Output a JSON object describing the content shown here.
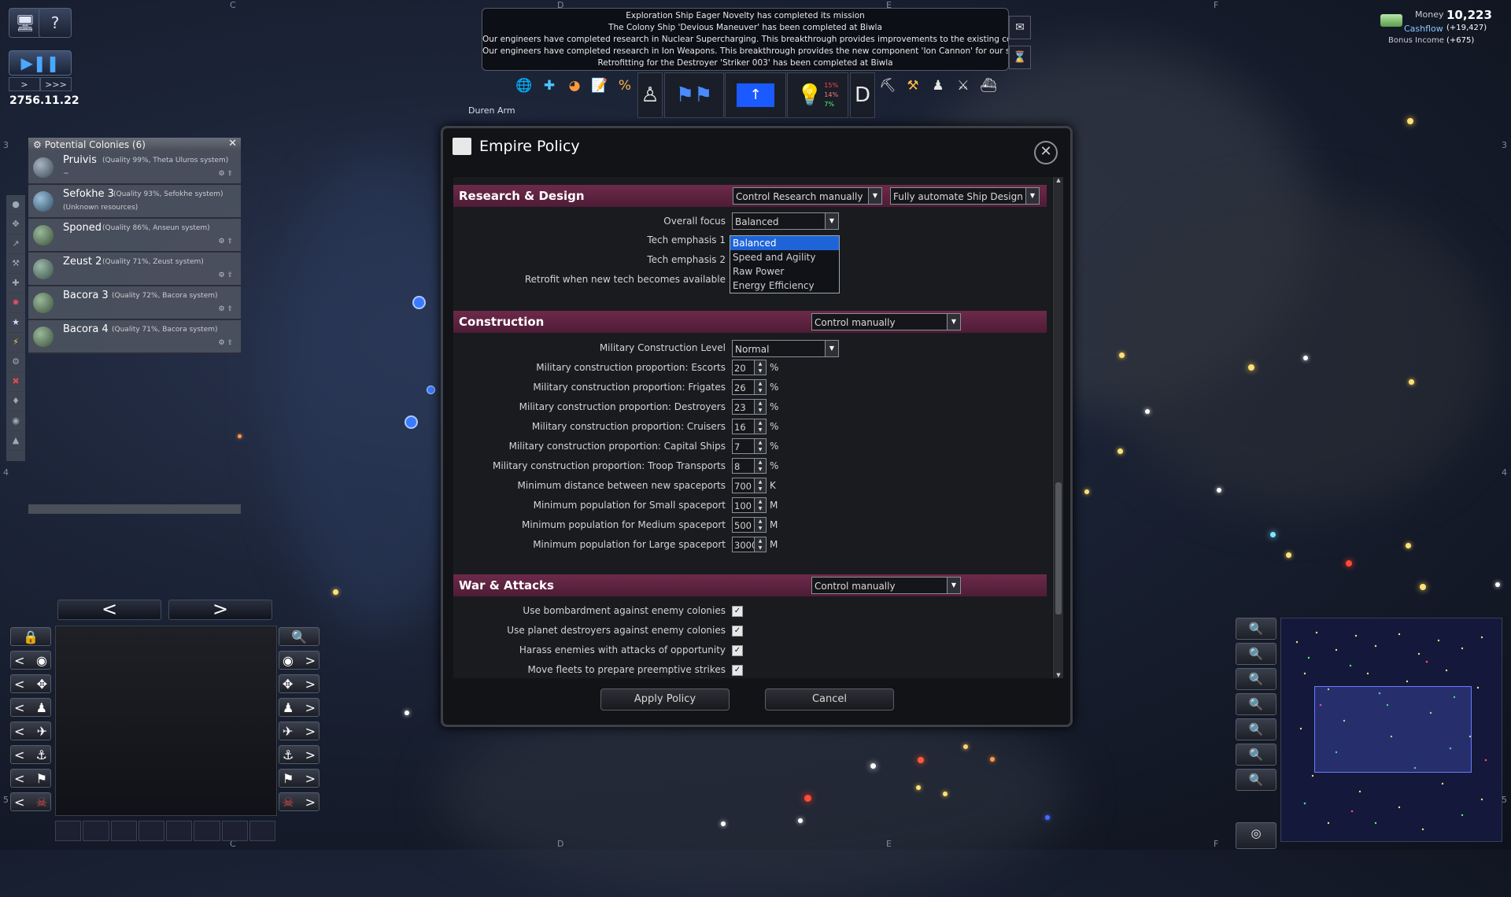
{
  "hud": {
    "date": "2756.11.22",
    "speed_slow": ">",
    "speed_fast": ">>>",
    "region_label": "Duren Arm",
    "money_label": "Money",
    "money_value": "10,223",
    "cashflow_label": "Cashflow",
    "cashflow_value": "(+19,427)",
    "bonus_label": "Bonus Income",
    "bonus_value": "(+675)"
  },
  "grid_letters": [
    "C",
    "D",
    "E",
    "F",
    "3",
    "4",
    "5",
    "3",
    "4",
    "5",
    "C",
    "D",
    "E",
    "F"
  ],
  "messages": [
    "Exploration Ship Eager Novelty has completed its mission",
    "The Colony Ship 'Devious Maneuver' has been completed at Biwla",
    "Our engineers have completed research in Nuclear Supercharging. This breakthrough provides improvements to the existing comp",
    "Our engineers have completed research in Ion Weapons. This breakthrough provides the new component 'Ion Cannon' for our ship",
    "Retrofitting for the Destroyer 'Striker 003' has been completed at Biwla"
  ],
  "toolbar": {
    "research_pct_1": "15%",
    "research_pct_2": "14%",
    "research_pct_3": "7%"
  },
  "colonies": {
    "title": "Potential Colonies (6)",
    "items": [
      {
        "name": "Pruivis",
        "quality": "(Quality 99%, Theta Uluros system)",
        "sub": "~"
      },
      {
        "name": "Sefokhe 3",
        "quality": "(Quality 93%, Sefokhe system)",
        "sub": "(Unknown resources)"
      },
      {
        "name": "Sponed",
        "quality": "(Quality 86%, Anseun system)",
        "sub": ""
      },
      {
        "name": "Zeust 2",
        "quality": "(Quality 71%, Zeust system)",
        "sub": ""
      },
      {
        "name": "Bacora 3",
        "quality": "(Quality 72%, Bacora system)",
        "sub": ""
      },
      {
        "name": "Bacora 4",
        "quality": "(Quality 71%, Bacora system)",
        "sub": ""
      }
    ]
  },
  "dialog": {
    "title": "Empire Policy",
    "research": {
      "label": "Research & Design",
      "mode": "Control Research manually",
      "ship_design": "Fully automate Ship Design",
      "overall_focus_label": "Overall focus",
      "overall_focus_value": "Balanced",
      "tech1_label": "Tech emphasis 1",
      "tech2_label": "Tech emphasis 2",
      "retrofit_label": "Retrofit when new tech becomes available",
      "focus_options": [
        "Balanced",
        "Speed and Agility",
        "Raw Power",
        "Energy Efficiency"
      ]
    },
    "construction": {
      "label": "Construction",
      "mode": "Control manually",
      "level_label": "Military Construction Level",
      "level_value": "Normal",
      "rows": [
        {
          "label": "Military construction proportion: Escorts",
          "value": "20",
          "unit": "%"
        },
        {
          "label": "Military construction proportion: Frigates",
          "value": "26",
          "unit": "%"
        },
        {
          "label": "Military construction proportion: Destroyers",
          "value": "23",
          "unit": "%"
        },
        {
          "label": "Military construction proportion: Cruisers",
          "value": "16",
          "unit": "%"
        },
        {
          "label": "Military construction proportion: Capital Ships",
          "value": "7",
          "unit": "%"
        },
        {
          "label": "Military construction proportion: Troop Transports",
          "value": "8",
          "unit": "%"
        },
        {
          "label": "Minimum distance between new spaceports",
          "value": "700",
          "unit": "K"
        },
        {
          "label": "Minimum population for Small spaceport",
          "value": "100",
          "unit": "M"
        },
        {
          "label": "Minimum population for Medium spaceport",
          "value": "500",
          "unit": "M"
        },
        {
          "label": "Minimum population for Large spaceport",
          "value": "3000",
          "unit": "M"
        }
      ]
    },
    "war": {
      "label": "War & Attacks",
      "mode": "Control manually",
      "rows": [
        {
          "label": "Use bombardment against enemy colonies",
          "checked": "✓"
        },
        {
          "label": "Use planet destroyers against enemy colonies",
          "checked": "✓"
        },
        {
          "label": "Harass enemies with attacks of opportunity",
          "checked": "✓"
        },
        {
          "label": "Move fleets to prepare preemptive strikes",
          "checked": "✓"
        }
      ]
    },
    "apply_label": "Apply Policy",
    "cancel_label": "Cancel"
  }
}
